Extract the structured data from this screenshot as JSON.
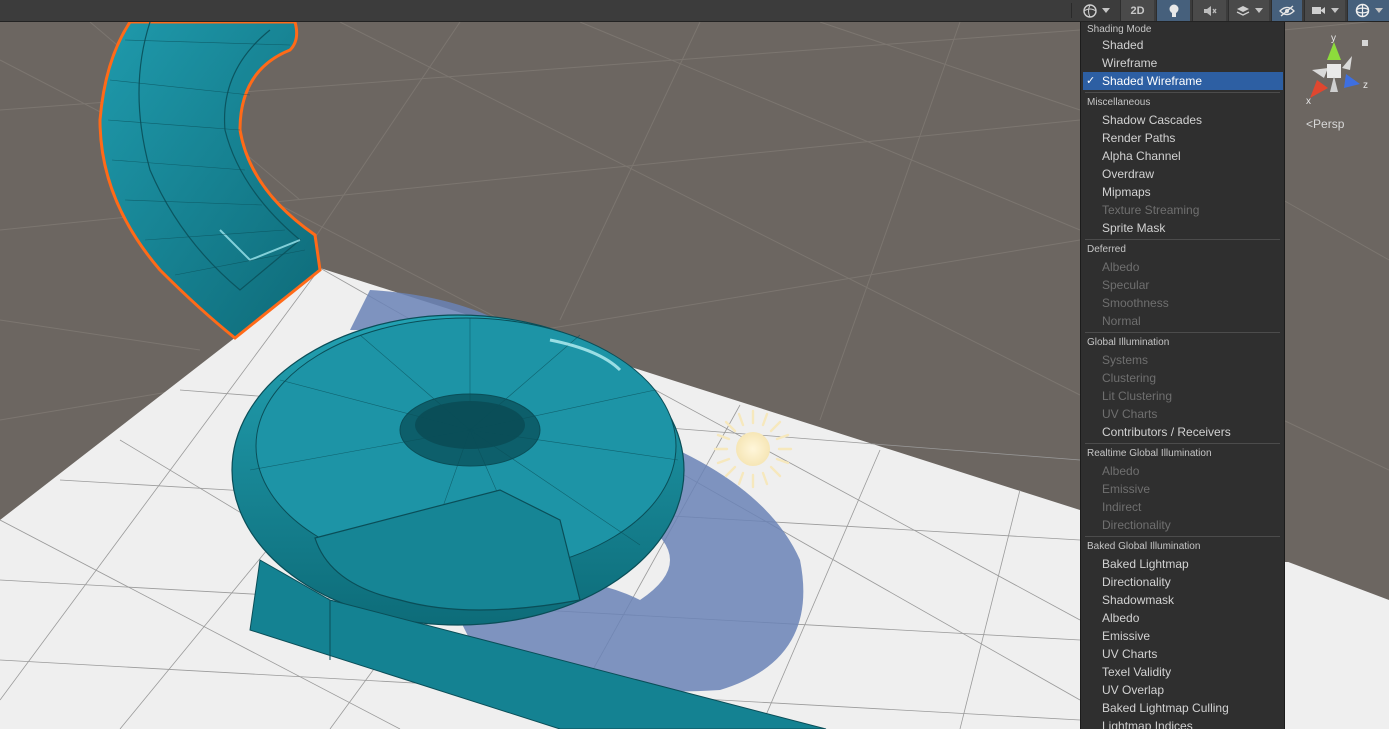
{
  "toolbar": {
    "two_d_label": "2D",
    "buttons": [
      "draw-mode-dropdown",
      "2d-toggle",
      "lighting-toggle",
      "audio-toggle",
      "effects-dropdown",
      "hidden-objects-toggle",
      "camera-dropdown",
      "gizmos-dropdown"
    ]
  },
  "menu": {
    "shading_mode": {
      "header": "Shading Mode",
      "items": [
        {
          "label": "Shaded"
        },
        {
          "label": "Wireframe"
        },
        {
          "label": "Shaded Wireframe",
          "checked": true,
          "check_mark": "✓"
        }
      ]
    },
    "miscellaneous": {
      "header": "Miscellaneous",
      "items": [
        "Shadow Cascades",
        "Render Paths",
        "Alpha Channel",
        "Overdraw",
        "Mipmaps",
        "Texture Streaming",
        "Sprite Mask"
      ],
      "disabled": [
        "Texture Streaming"
      ]
    },
    "deferred": {
      "header": "Deferred",
      "items": [
        "Albedo",
        "Specular",
        "Smoothness",
        "Normal"
      ],
      "disabled": [
        "Albedo",
        "Specular",
        "Smoothness",
        "Normal"
      ]
    },
    "global_illumination": {
      "header": "Global Illumination",
      "items": [
        "Systems",
        "Clustering",
        "Lit Clustering",
        "UV Charts",
        "Contributors / Receivers"
      ],
      "disabled": [
        "Systems",
        "Clustering",
        "Lit Clustering",
        "UV Charts"
      ]
    },
    "realtime_gi": {
      "header": "Realtime Global Illumination",
      "items": [
        "Albedo",
        "Emissive",
        "Indirect",
        "Directionality"
      ],
      "disabled": [
        "Albedo",
        "Emissive",
        "Indirect",
        "Directionality"
      ]
    },
    "baked_gi": {
      "header": "Baked Global Illumination",
      "items": [
        "Baked Lightmap",
        "Directionality",
        "Shadowmask",
        "Albedo",
        "Emissive",
        "UV Charts",
        "Texel Validity",
        "UV Overlap",
        "Baked Lightmap Culling",
        "Lightmap Indices"
      ]
    }
  },
  "gizmo": {
    "axis_y": "y",
    "axis_x": "x",
    "axis_z": "z",
    "projection": "Persp",
    "projection_arrow": "<",
    "colors": {
      "y": "#8ddc3c",
      "x": "#e0472f",
      "z": "#3e6fe0"
    }
  },
  "colors": {
    "selection_outline": "#ff6a18",
    "mesh_teal": "#1a8a9a",
    "menu_highlight": "#2d5fa3",
    "ground_plane": "#f1f1f1"
  },
  "icons": [
    "draw-mode-icon",
    "light-bulb-icon",
    "audio-mute-icon",
    "layers-icon",
    "hidden-eye-icon",
    "camera-icon",
    "gizmo-globe-icon",
    "sun-light-icon",
    "check-icon"
  ]
}
